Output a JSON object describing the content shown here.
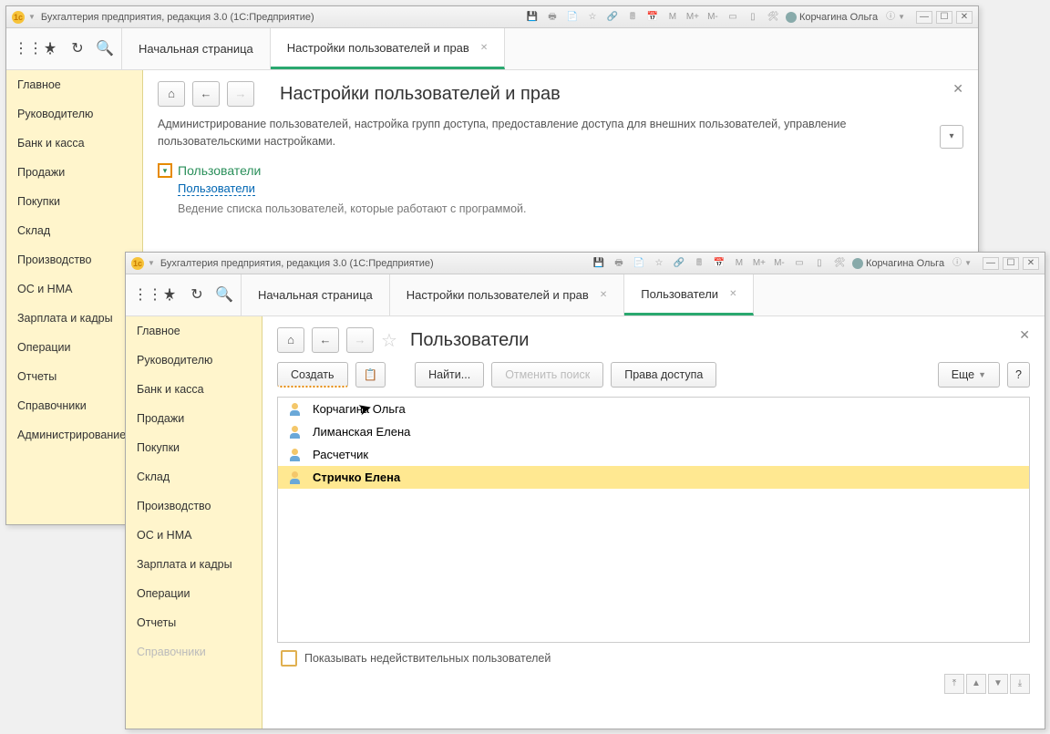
{
  "app_title": "Бухгалтерия предприятия, редакция 3.0  (1С:Предприятие)",
  "current_user": "Корчагина Ольга",
  "sidebar": {
    "items": [
      {
        "label": "Главное"
      },
      {
        "label": "Руководителю"
      },
      {
        "label": "Банк и касса"
      },
      {
        "label": "Продажи"
      },
      {
        "label": "Покупки"
      },
      {
        "label": "Склад"
      },
      {
        "label": "Производство"
      },
      {
        "label": "ОС и НМА"
      },
      {
        "label": "Зарплата и кадры"
      },
      {
        "label": "Операции"
      },
      {
        "label": "Отчеты"
      },
      {
        "label": "Справочники"
      },
      {
        "label": "Администрирование"
      }
    ]
  },
  "win1": {
    "tabs": [
      {
        "label": "Начальная страница"
      },
      {
        "label": "Настройки пользователей и прав"
      }
    ],
    "page_title": "Настройки пользователей и прав",
    "description": "Администрирование пользователей, настройка групп доступа, предоставление доступа для внешних пользователей, управление пользовательскими настройками.",
    "section_title": "Пользователи",
    "section_link": "Пользователи",
    "section_desc": "Ведение списка пользователей, которые работают с программой."
  },
  "win2": {
    "tabs": [
      {
        "label": "Начальная страница"
      },
      {
        "label": "Настройки пользователей и прав"
      },
      {
        "label": "Пользователи"
      }
    ],
    "page_title": "Пользователи",
    "buttons": {
      "create": "Создать",
      "find": "Найти...",
      "cancel_search": "Отменить поиск",
      "access_rights": "Права доступа",
      "more": "Еще"
    },
    "users": [
      {
        "name": "Корчагина Ольга"
      },
      {
        "name": "Лиманская Елена"
      },
      {
        "name": "Расчетчик"
      },
      {
        "name": "Стричко Елена",
        "selected": true
      }
    ],
    "show_invalid_label": "Показывать недействительных пользователей"
  },
  "title_icons": {
    "m": "M",
    "mp": "M+",
    "mm": "M-"
  }
}
